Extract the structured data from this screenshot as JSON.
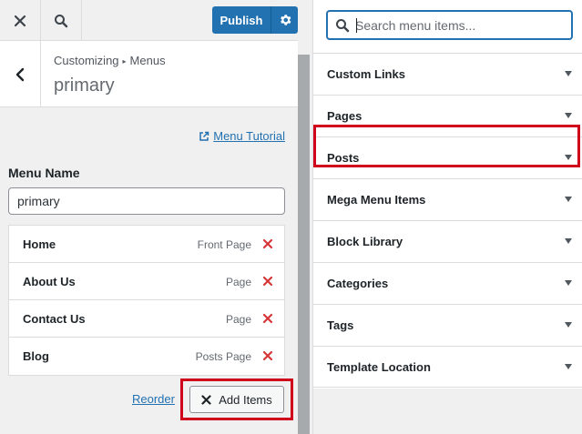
{
  "topbar": {
    "close_icon": "close-icon",
    "search_icon": "search-icon",
    "publish_label": "Publish",
    "gear_icon": "gear-icon"
  },
  "header": {
    "breadcrumb_root": "Customizing",
    "breadcrumb_sep": "▸",
    "breadcrumb_current": "Menus",
    "title": "primary"
  },
  "content": {
    "tutorial_label": "Menu Tutorial",
    "menu_name_label": "Menu Name",
    "menu_name_value": "primary",
    "menu_items": [
      {
        "title": "Home",
        "type": "Front Page"
      },
      {
        "title": "About Us",
        "type": "Page"
      },
      {
        "title": "Contact Us",
        "type": "Page"
      },
      {
        "title": "Blog",
        "type": "Posts Page"
      }
    ],
    "reorder_label": "Reorder",
    "add_items_label": "Add Items"
  },
  "available": {
    "search_placeholder": "Search menu items...",
    "sections": [
      {
        "label": "Custom Links"
      },
      {
        "label": "Pages"
      },
      {
        "label": "Posts"
      },
      {
        "label": "Mega Menu Items"
      },
      {
        "label": "Block Library"
      },
      {
        "label": "Categories"
      },
      {
        "label": "Tags"
      },
      {
        "label": "Template Location"
      }
    ]
  },
  "colors": {
    "accent": "#2271b1",
    "remove": "#d63638",
    "highlight": "#d0021b"
  }
}
